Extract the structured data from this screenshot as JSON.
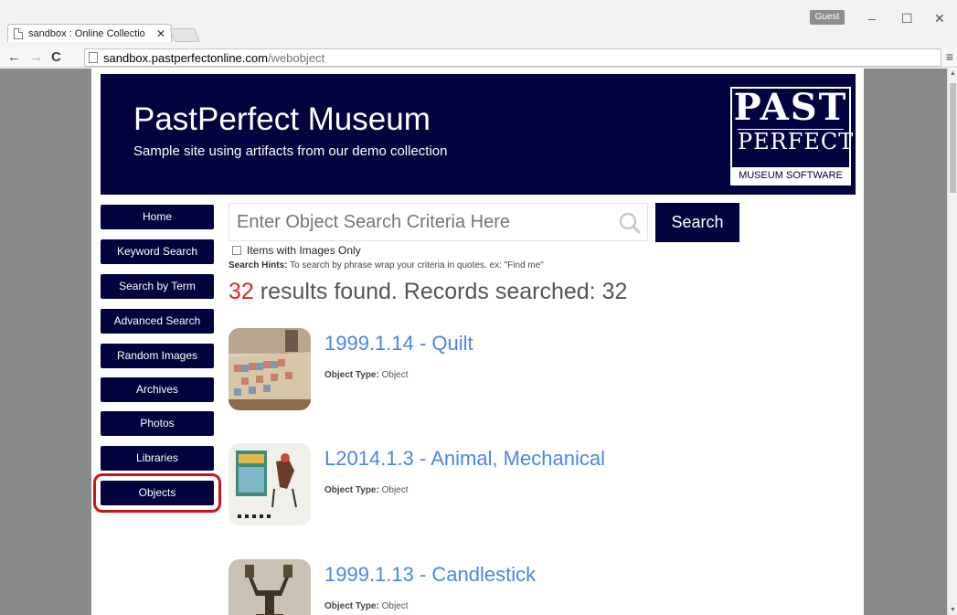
{
  "browser": {
    "tab_title": "sandbox : Online Collectio",
    "tab_close": "✕",
    "user_badge": "Guest",
    "url_host": "sandbox.pastperfectonline.com",
    "url_path": "/webobject",
    "back_icon": "back-arrow-icon",
    "forward_icon": "forward-arrow-icon",
    "reload_icon": "reload-icon",
    "menu_icon": "hamburger-menu-icon"
  },
  "header": {
    "title": "PastPerfect Museum",
    "subtitle": "Sample site using artifacts from our demo collection",
    "logo_line1": "PAST",
    "logo_line2": "PERFECT",
    "logo_line3": "MUSEUM SOFTWARE",
    "background_color": "#02023e"
  },
  "sidebar": {
    "items": [
      {
        "label": "Home"
      },
      {
        "label": "Keyword Search"
      },
      {
        "label": "Search by Term"
      },
      {
        "label": "Advanced Search"
      },
      {
        "label": "Random Images"
      },
      {
        "label": "Archives"
      },
      {
        "label": "Photos"
      },
      {
        "label": "Libraries"
      },
      {
        "label": "Objects",
        "highlighted": true
      }
    ],
    "highlight_color": "#c8161d"
  },
  "search": {
    "placeholder": "Enter Object Search Criteria Here",
    "button_label": "Search",
    "images_only_label": "Items with Images Only",
    "images_only_checked": false,
    "hints_label": "Search Hints:",
    "hints_text": "To search by phrase wrap your criteria in quotes. ex: \"Find me\""
  },
  "results": {
    "count": "32",
    "summary_text": "results found. Records searched: 32",
    "type_label": "Object Type:",
    "items": [
      {
        "title": "1999.1.14 - Quilt",
        "type": "Object"
      },
      {
        "title": "L2014.1.3 - Animal, Mechanical",
        "type": "Object"
      },
      {
        "title": "1999.1.13 - Candlestick",
        "type": "Object"
      }
    ],
    "link_color": "#4a86e8",
    "count_color": "#d9272e"
  }
}
